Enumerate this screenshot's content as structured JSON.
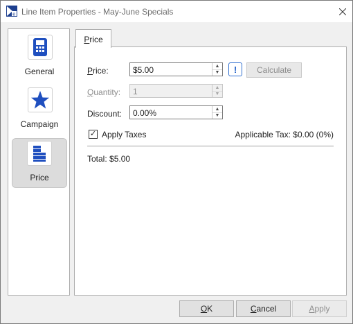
{
  "window": {
    "title": "Line Item Properties - May-June Specials"
  },
  "sidebar": {
    "items": [
      {
        "label": "General",
        "icon": "calculator-icon"
      },
      {
        "label": "Campaign",
        "icon": "star-icon"
      },
      {
        "label": "Price",
        "icon": "price-stack-icon",
        "selected": true
      }
    ]
  },
  "tabs": [
    {
      "label": "Price"
    }
  ],
  "form": {
    "price_label": "Price:",
    "price_value": "$5.00",
    "calculate_label": "Calculate",
    "quantity_label": "Quantity:",
    "quantity_value": "1",
    "discount_label": "Discount:",
    "discount_value": "0.00%",
    "apply_taxes_label": "Apply Taxes",
    "apply_taxes_checked": true,
    "applicable_tax": "Applicable Tax: $0.00 (0%)",
    "total": "Total: $5.00"
  },
  "footer": {
    "ok_label": "OK",
    "cancel_label": "Cancel",
    "apply_label": "Apply"
  },
  "colors": {
    "accent_blue": "#1f4fbf",
    "selected_bg": "#dcdcdc"
  }
}
